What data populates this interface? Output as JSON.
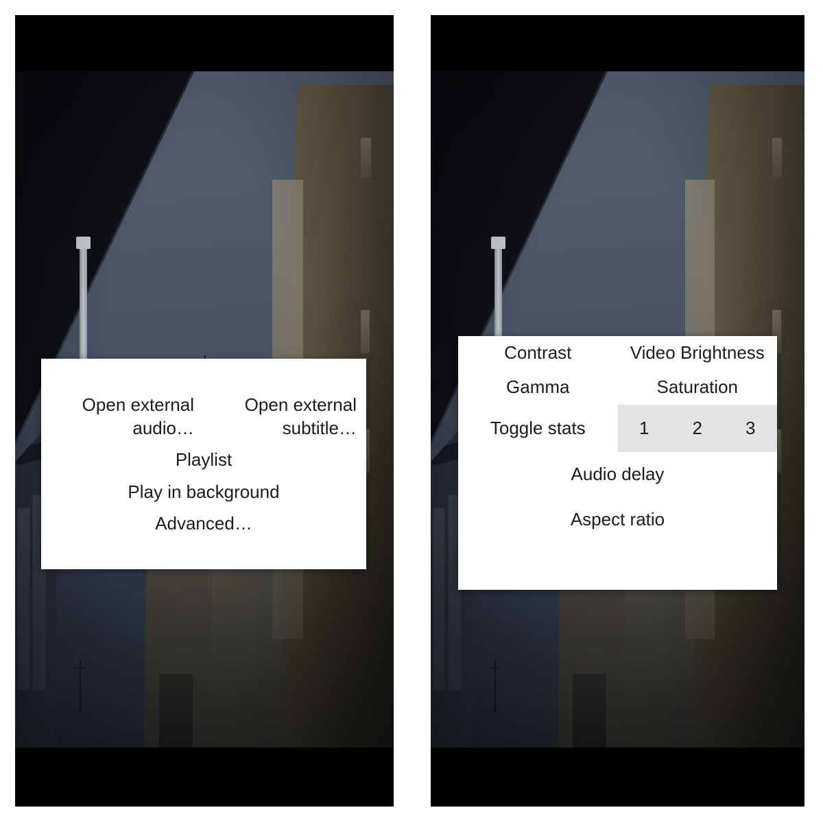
{
  "app": {
    "kind": "video-player",
    "screens": 2
  },
  "colors": {
    "letterbox": "#000000",
    "sky": "#4a5466",
    "dialog_bg": "#ffffff",
    "dialog_text": "#1c1c1c",
    "segment_highlight": "#e3e3e3",
    "page_bg": "#ffffff"
  },
  "left_screen": {
    "name": "open-menu-screen",
    "dialog": {
      "name": "open-options-dialog",
      "rows": [
        {
          "type": "two-column",
          "items": [
            {
              "label": "Open external audio…",
              "align": "right"
            },
            {
              "label": "Open external subtitle…",
              "align": "right"
            }
          ]
        },
        {
          "type": "full",
          "items": [
            {
              "label": "Playlist",
              "align": "center"
            }
          ]
        },
        {
          "type": "full",
          "items": [
            {
              "label": "Play in background",
              "align": "center"
            }
          ]
        },
        {
          "type": "full",
          "items": [
            {
              "label": "Advanced…",
              "align": "center"
            }
          ]
        }
      ]
    }
  },
  "right_screen": {
    "name": "advanced-menu-screen",
    "dialog": {
      "name": "video-options-dialog",
      "rows": [
        {
          "type": "two-column",
          "left": {
            "label": "Contrast"
          },
          "right": {
            "label": "Video Brightness"
          }
        },
        {
          "type": "two-column",
          "left": {
            "label": "Gamma"
          },
          "right": {
            "label": "Saturation"
          }
        },
        {
          "type": "two-column-segmented",
          "left": {
            "label": "Toggle stats"
          },
          "segments": [
            "1",
            "2",
            "3"
          ],
          "segments_highlighted": true
        },
        {
          "type": "full",
          "label": "Audio delay"
        },
        {
          "type": "full",
          "label": "Aspect ratio"
        }
      ]
    }
  }
}
